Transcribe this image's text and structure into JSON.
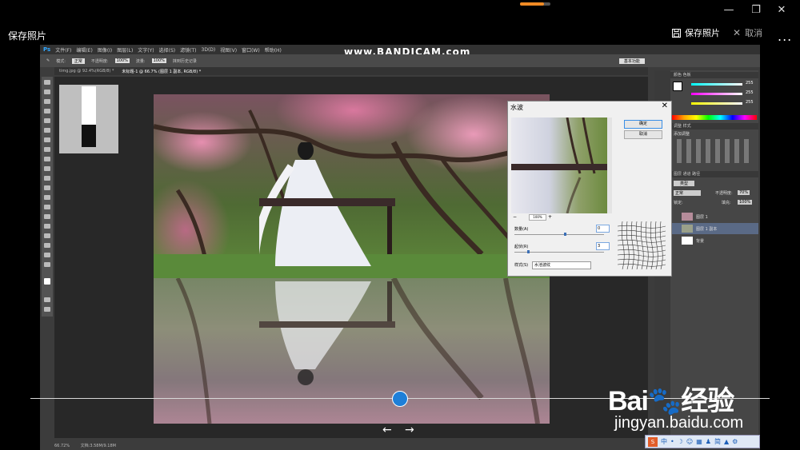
{
  "window": {
    "minimize": "—",
    "restore": "❐",
    "close": "✕"
  },
  "viewer": {
    "title": "保存照片",
    "save_label": "保存照片",
    "cancel_label": "取消",
    "more_label": "..."
  },
  "watermark": "www.BANDICAM.com",
  "photoshop": {
    "logo": "Ps",
    "menu": [
      "文件(F)",
      "编辑(E)",
      "图像(I)",
      "图层(L)",
      "文字(Y)",
      "选择(S)",
      "滤镜(T)",
      "3D(D)",
      "视图(V)",
      "窗口(W)",
      "帮助(H)"
    ],
    "options": {
      "mode_label": "模式:",
      "mode_value": "正常",
      "opacity_label": "不透明度:",
      "opacity_value": "100%",
      "flow_label": "流量:",
      "flow_value": "100%",
      "history_label": "抹到历史记录",
      "workspace": "基本功能"
    },
    "tabs": [
      "timg.jpg @ 92.4%(RGB/8) *",
      "未标题-1 @ 66.7% (图层 1 副本, RGB/8) *"
    ],
    "status_zoom": "66.72%",
    "status_doc": "文档:3.58M/9.18M",
    "panels": {
      "color_tabs": "颜色  色板",
      "r": "255",
      "g": "255",
      "b": "255",
      "adjust_tabs": "调整  样式",
      "adjust_add": "添加调整",
      "layers_tabs": "图层  通道  路径",
      "kind": "类型",
      "blend": "正常",
      "opacity_label": "不透明度:",
      "opacity": "70%",
      "lock_label": "锁定:",
      "fill_label": "填充:",
      "fill": "100%",
      "layers": [
        {
          "name": "图层 1"
        },
        {
          "name": "图层 1 副本"
        },
        {
          "name": "背景"
        }
      ]
    },
    "dialog": {
      "title": "水波",
      "close": "✕",
      "ok": "确定",
      "cancel": "取消",
      "zoom": "100%",
      "amount_label": "数量(A)",
      "amount_value": "0",
      "ridges_label": "起伏(R)",
      "ridges_value": "3",
      "style_label": "样式(S)",
      "style_value": "水池波纹"
    }
  },
  "scrubber": {
    "position": 0.5,
    "prev": "←",
    "next": "→"
  },
  "brand": {
    "logo": "Bai🐾经验",
    "url": "jingyan.baidu.com"
  },
  "ime": {
    "logo": "S",
    "items": [
      "中",
      "•",
      "☽",
      "☺",
      "▦",
      "♟",
      "简",
      "▲",
      "⚙"
    ]
  }
}
